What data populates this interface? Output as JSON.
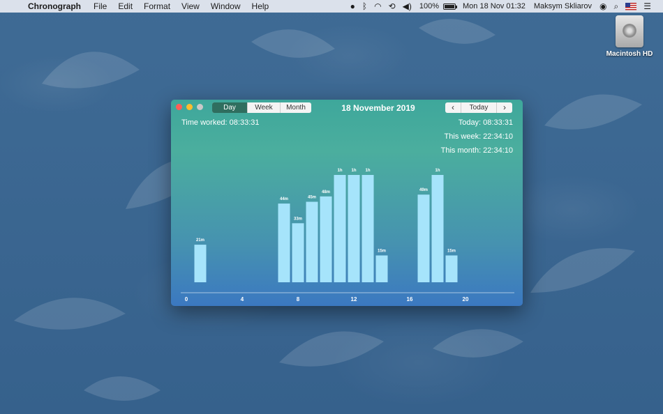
{
  "menubar": {
    "app": "Chronograph",
    "items": [
      "File",
      "Edit",
      "Format",
      "View",
      "Window",
      "Help"
    ],
    "battery": "100%",
    "datetime": "Mon 18 Nov  01:32",
    "user": "Maksym Skliarov"
  },
  "desktop": {
    "hd_label": "Macintosh HD"
  },
  "window": {
    "tabs": {
      "day": "Day",
      "week": "Week",
      "month": "Month"
    },
    "date_title": "18 November 2019",
    "nav": {
      "prev": "‹",
      "today": "Today",
      "next": "›"
    },
    "time_worked": "Time worked: 08:33:31",
    "today": "Today: 08:33:31",
    "this_week": "This week: 22:34:10",
    "this_month": "This month: 22:34:10"
  },
  "chart_data": {
    "type": "bar",
    "xlim": [
      0,
      24
    ],
    "x_ticks": [
      0,
      4,
      8,
      12,
      16,
      20
    ],
    "ylim": [
      0,
      60
    ],
    "bars": [
      {
        "hour": 1,
        "minutes": 21,
        "label": "21m"
      },
      {
        "hour": 7,
        "minutes": 44,
        "label": "44m"
      },
      {
        "hour": 8,
        "minutes": 33,
        "label": "33m"
      },
      {
        "hour": 9,
        "minutes": 45,
        "label": "45m"
      },
      {
        "hour": 10,
        "minutes": 48,
        "label": "48m"
      },
      {
        "hour": 11,
        "minutes": 60,
        "label": "1h"
      },
      {
        "hour": 12,
        "minutes": 60,
        "label": "1h"
      },
      {
        "hour": 13,
        "minutes": 60,
        "label": "1h"
      },
      {
        "hour": 14,
        "minutes": 15,
        "label": "15m"
      },
      {
        "hour": 17,
        "minutes": 49,
        "label": "49m"
      },
      {
        "hour": 18,
        "minutes": 60,
        "label": "1h"
      },
      {
        "hour": 19,
        "minutes": 15,
        "label": "15m"
      }
    ],
    "bar_color": "#a6e4fb"
  }
}
